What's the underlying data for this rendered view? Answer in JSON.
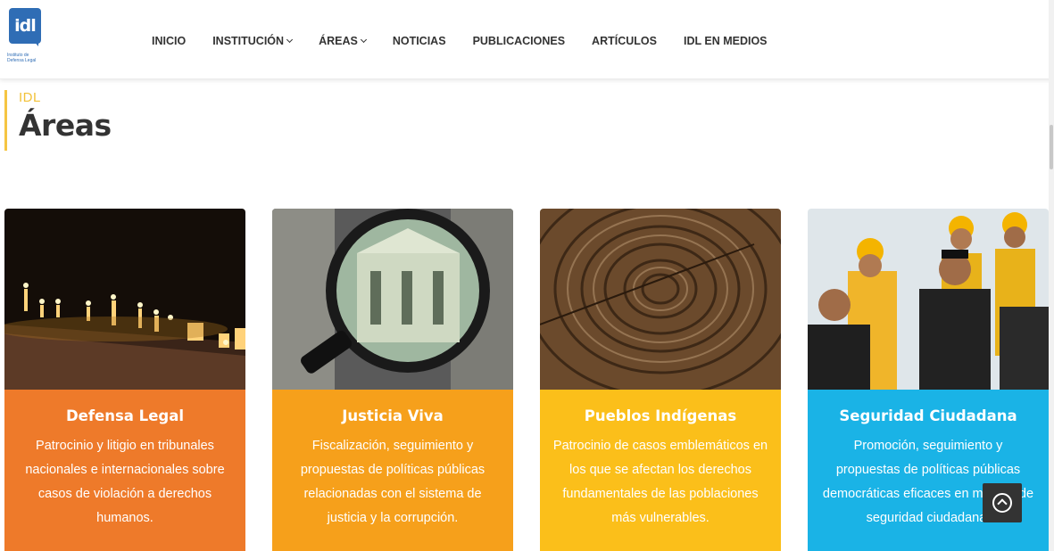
{
  "logo": {
    "mark": "idl",
    "caption": "Instituto de Defensa Legal"
  },
  "nav": {
    "items": [
      {
        "label": "INICIO",
        "has_dropdown": false
      },
      {
        "label": "INSTITUCIÓN",
        "has_dropdown": true
      },
      {
        "label": "ÁREAS",
        "has_dropdown": true
      },
      {
        "label": "NOTICIAS",
        "has_dropdown": false
      },
      {
        "label": "PUBLICACIONES",
        "has_dropdown": false
      },
      {
        "label": "ARTÍCULOS",
        "has_dropdown": false
      },
      {
        "label": "IDL EN MEDIOS",
        "has_dropdown": false
      }
    ]
  },
  "page": {
    "kicker": "IDL",
    "title": "Áreas"
  },
  "cards": [
    {
      "title": "Defensa Legal",
      "desc": "Patrocinio y litigio en tribunales nacionales e internacionales sobre casos de violación a derechos humanos.",
      "color": "#ee7a2a",
      "image": "candles-photo"
    },
    {
      "title": "Justicia Viva",
      "desc": "Fiscalización, seguimiento y propuestas de políticas públicas relacionadas con el sistema de justicia y la corrupción.",
      "color": "#f6a01b",
      "image": "courthouse-magnifier-photo"
    },
    {
      "title": "Pueblos Indígenas",
      "desc": "Patrocinio de casos emblemáticos en los que se afectan los derechos fundamentales de las poblaciones más vulnerables.",
      "color": "#fbbf1a",
      "image": "tree-rings-photo"
    },
    {
      "title": "Seguridad Ciudadana",
      "desc": "Promoción, seguimiento y propuestas de políticas públicas democráticas eficaces en materia de seguridad ciudadana.",
      "color": "#1ab3e6",
      "image": "security-patrol-photo"
    }
  ],
  "back_to_top": {
    "icon": "arrow-up-circle-icon"
  }
}
